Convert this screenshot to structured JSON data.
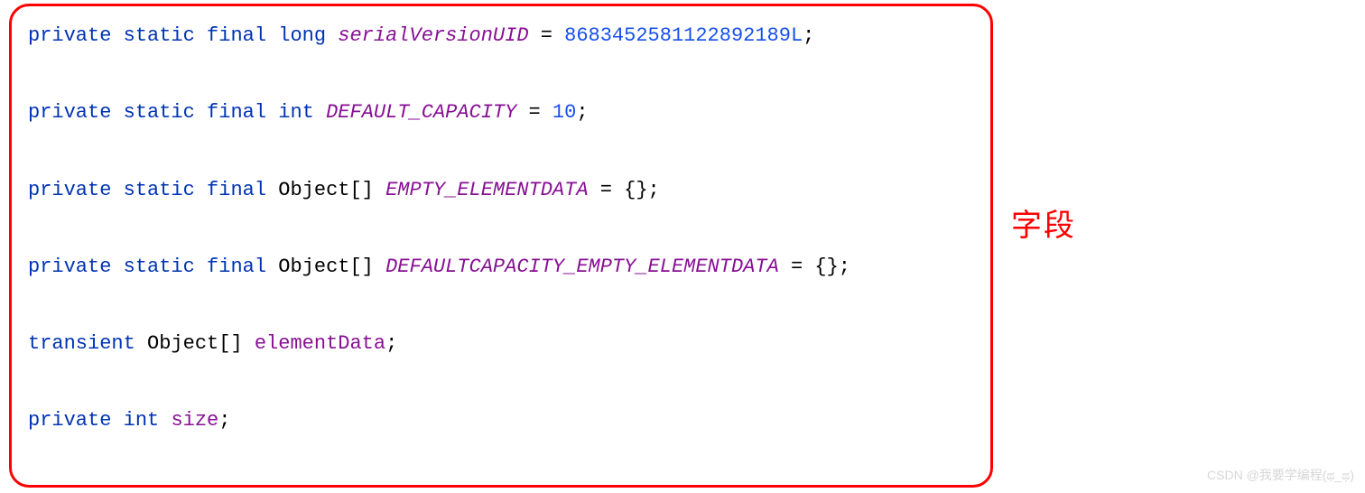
{
  "annotation_label": "字段",
  "watermark": "CSDN @我要学编程(ಥ_ಥ)",
  "code": {
    "line1": {
      "kw1": "private",
      "sp": " ",
      "kw2": "static",
      "kw3": "final",
      "kw4": "long",
      "ident": "serialVersionUID",
      "eq": " = ",
      "val": "8683452581122892189L",
      "semi": ";"
    },
    "line2": {
      "kw1": "private",
      "kw2": "static",
      "kw3": "final",
      "kw4": "int",
      "ident": "DEFAULT_CAPACITY",
      "eq": " = ",
      "val": "10",
      "semi": ";"
    },
    "line3": {
      "kw1": "private",
      "kw2": "static",
      "kw3": "final",
      "type": "Object[]",
      "ident": "EMPTY_ELEMENTDATA",
      "eq": " = ",
      "val": "{}",
      "semi": ";"
    },
    "line4": {
      "kw1": "private",
      "kw2": "static",
      "kw3": "final",
      "type": "Object[]",
      "ident": "DEFAULTCAPACITY_EMPTY_ELEMENTDATA",
      "eq": " = ",
      "val": "{}",
      "semi": ";"
    },
    "line5": {
      "kw1": "transient",
      "type": "Object[]",
      "ident": "elementData",
      "semi": ";"
    },
    "line6": {
      "kw1": "private",
      "kw2": "int",
      "ident": "size",
      "semi": ";"
    }
  }
}
